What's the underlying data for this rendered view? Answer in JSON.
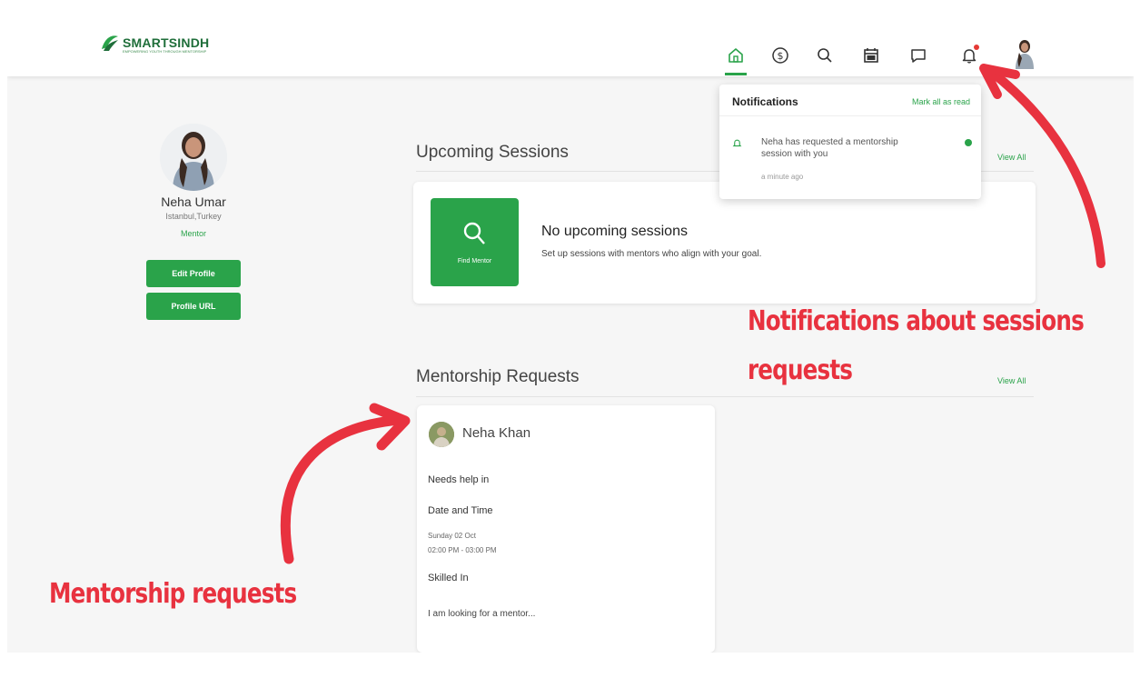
{
  "brand": {
    "name": "SMARTSINDH",
    "tagline": "EMPOWERING YOUTH THROUGH MENTORSHIP",
    "color": "#1f6e3a"
  },
  "colors": {
    "accent": "#2aa34a",
    "annotation": "#e8323f",
    "badge": "#e53935"
  },
  "nav": {
    "icons": [
      "home-icon",
      "dollar-icon",
      "search-icon",
      "calendar-icon",
      "chat-icon",
      "bell-icon"
    ],
    "active": "home-icon",
    "notification_badge": true
  },
  "profile": {
    "name": "Neha Umar",
    "location": "Istanbul,Turkey",
    "role": "Mentor",
    "edit_button": "Edit Profile",
    "url_button": "Profile URL"
  },
  "sessions": {
    "title": "Upcoming Sessions",
    "view_all": "View All",
    "find_mentor": "Find Mentor",
    "empty_title": "No upcoming sessions",
    "empty_subtitle": "Set up sessions with mentors who align with your goal."
  },
  "requests": {
    "title": "Mentorship Requests",
    "view_all": "View All",
    "card": {
      "name": "Neha Khan",
      "needs_label": "Needs help in",
      "date_label": "Date and Time",
      "date": "Sunday 02 Oct",
      "time": "02:00 PM - 03:00 PM",
      "skilled_label": "Skilled In",
      "message": "I am looking for a mentor..."
    }
  },
  "notifications": {
    "title": "Notifications",
    "mark_all": "Mark all as read",
    "items": [
      {
        "text": "Neha has requested a mentorship session with you",
        "time": "a minute ago",
        "unread": true
      }
    ]
  },
  "annotations": {
    "notif_line1": "Notifications about sessions",
    "notif_line2": "requests",
    "requests_label": "Mentorship requests"
  }
}
